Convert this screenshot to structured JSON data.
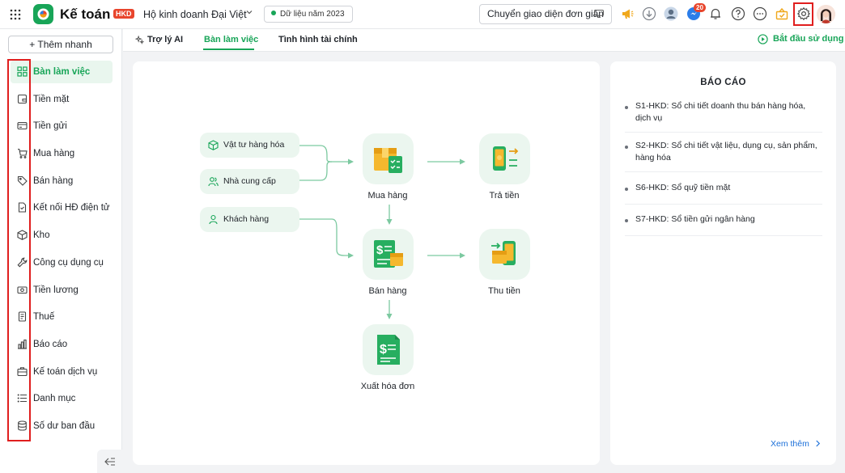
{
  "header": {
    "app_name": "Kế toán",
    "badge": "HKD",
    "business_name": "Hộ kinh doanh Đại Việt",
    "data_year": "Dữ liệu năm 2023",
    "switch_ui_label": "Chuyển giao diện đơn giản",
    "notification_count": "20",
    "icons": [
      "apps-grid-icon",
      "megaphone-icon",
      "download-icon",
      "user-avatar-icon",
      "chat-icon",
      "bell-icon",
      "help-icon",
      "more-icon",
      "gift-icon",
      "settings-gear-icon",
      "profile-avatar"
    ]
  },
  "sidebar": {
    "quick_add": "+ Thêm nhanh",
    "items": [
      {
        "label": "Bàn làm việc",
        "icon": "dashboard-icon",
        "active": true
      },
      {
        "label": "Tiền mặt",
        "icon": "cash-icon"
      },
      {
        "label": "Tiền gửi",
        "icon": "card-icon"
      },
      {
        "label": "Mua hàng",
        "icon": "cart-icon"
      },
      {
        "label": "Bán hàng",
        "icon": "tag-icon"
      },
      {
        "label": "Kết nối HĐ điện tử",
        "icon": "e-invoice-icon"
      },
      {
        "label": "Kho",
        "icon": "box-icon"
      },
      {
        "label": "Công cụ dụng cụ",
        "icon": "wrench-icon"
      },
      {
        "label": "Tiền lương",
        "icon": "salary-icon"
      },
      {
        "label": "Thuế",
        "icon": "tax-icon"
      },
      {
        "label": "Báo cáo",
        "icon": "report-icon"
      },
      {
        "label": "Kế toán dịch vụ",
        "icon": "briefcase-icon"
      },
      {
        "label": "Danh mục",
        "icon": "list-icon"
      },
      {
        "label": "Số dư ban đầu",
        "icon": "database-icon"
      }
    ]
  },
  "tabs": [
    {
      "label": "Trợ lý AI"
    },
    {
      "label": "Bàn làm việc",
      "active": true
    },
    {
      "label": "Tình hình tài chính"
    }
  ],
  "start_link": "Bắt đầu sử dụng",
  "flow": {
    "pills": [
      "Vật tư hàng hóa",
      "Nhà cung cấp",
      "Khách hàng"
    ],
    "nodes": [
      "Mua hàng",
      "Trả tiền",
      "Bán hàng",
      "Thu tiền",
      "Xuất hóa đơn"
    ]
  },
  "report": {
    "title": "BÁO CÁO",
    "items": [
      "S1-HKD: Sổ chi tiết doanh thu bán hàng hóa, dịch vụ",
      "S2-HKD: Sổ chi tiết vật liệu, dụng cụ, sản phẩm, hàng hóa",
      "S6-HKD: Sổ quỹ tiền mặt",
      "S7-HKD: Sổ tiền gửi ngân hàng"
    ],
    "see_more": "Xem thêm"
  },
  "colors": {
    "accent": "#18a558",
    "alert": "#e8452c",
    "link": "#1a6fd9",
    "highlight": "#e01e1e"
  }
}
